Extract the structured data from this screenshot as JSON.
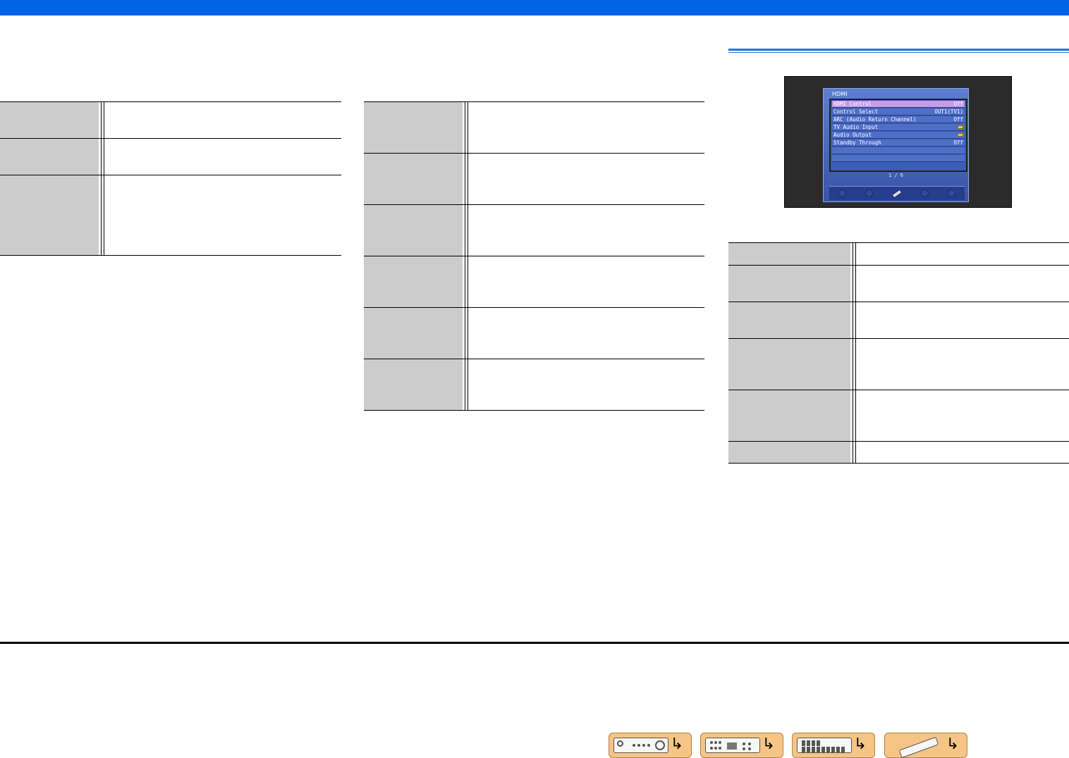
{
  "colors": {
    "header_bar": "#0062e6",
    "section_rule": "#2f6fd6",
    "label_cell": "#cccccc",
    "nav_button": "#f6c585",
    "osd_selected": "#c79be6"
  },
  "osd_screen": {
    "title": "HDMI",
    "items": [
      {
        "label": "HDMI Control",
        "value": "Off",
        "selected": true
      },
      {
        "label": "Control Select",
        "value": "OUT1(TV1)"
      },
      {
        "label": "ARC (Audio Return Channel)",
        "value": "Off"
      },
      {
        "label": "TV Audio Input",
        "value_icon": "folder-icon"
      },
      {
        "label": "Audio Output",
        "value_icon": "folder-icon"
      },
      {
        "label": "Standby Through",
        "value": "Off"
      }
    ],
    "page": "1 / 6"
  },
  "footer_nav": [
    {
      "icon": "front-panel-icon"
    },
    {
      "icon": "rear-panel-icon"
    },
    {
      "icon": "display-panel-icon"
    },
    {
      "icon": "remote-control-icon"
    }
  ],
  "nav_arrow_glyph": "↳"
}
